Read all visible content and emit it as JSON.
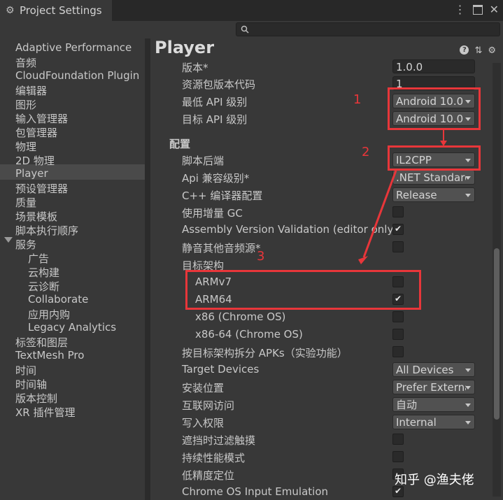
{
  "window": {
    "title": "Project Settings"
  },
  "sidebar": {
    "items": [
      "Adaptive Performance",
      "音频",
      "CloudFoundation Plugin",
      "编辑器",
      "图形",
      "输入管理器",
      "包管理器",
      "物理",
      "2D 物理",
      "Player",
      "预设管理器",
      "质量",
      "场景模板",
      "脚本执行顺序",
      "服务",
      "广告",
      "云构建",
      "云诊断",
      "Collaborate",
      "应用内购",
      "Legacy Analytics",
      "标签和图层",
      "TextMesh Pro",
      "时间",
      "时间轴",
      "版本控制",
      "XR 插件管理"
    ]
  },
  "main": {
    "title": "Player",
    "rows": {
      "version": {
        "label": "版本*",
        "value": "1.0.0"
      },
      "bundle_code": {
        "label": "资源包版本代码",
        "value": "1"
      },
      "min_api": {
        "label": "最低 API 级别",
        "value": "Android 10.0"
      },
      "target_api": {
        "label": "目标 API 级别",
        "value": "Android 10.0"
      },
      "config_header": "配置",
      "scripting_backend": {
        "label": "脚本后端",
        "value": "IL2CPP"
      },
      "api_compat": {
        "label": "Api 兼容级别*",
        "value": ".NET Standard"
      },
      "cpp_config": {
        "label": "C++ 编译器配置",
        "value": "Release"
      },
      "incremental_gc": {
        "label": "使用增量 GC"
      },
      "assembly_validation": {
        "label": "Assembly Version Validation (editor only)"
      },
      "mute_audio": {
        "label": "静音其他音频源*"
      },
      "target_arch": {
        "label": "目标架构"
      },
      "armv7": {
        "label": "ARMv7"
      },
      "arm64": {
        "label": "ARM64"
      },
      "x86": {
        "label": "x86 (Chrome OS)"
      },
      "x86_64": {
        "label": "x86-64 (Chrome OS)"
      },
      "split_apks": {
        "label": "按目标架构拆分 APKs（实验功能）"
      },
      "target_devices": {
        "label": "Target Devices",
        "value": "All Devices"
      },
      "install_location": {
        "label": "安装位置",
        "value": "Prefer External"
      },
      "internet_access": {
        "label": "互联网访问",
        "value": "自动"
      },
      "write_permission": {
        "label": "写入权限",
        "value": "Internal"
      },
      "filter_touches": {
        "label": "遮挡时过滤触摸"
      },
      "sustained_perf": {
        "label": "持续性能模式"
      },
      "low_accuracy": {
        "label": "低精度定位"
      },
      "chrome_os_input": {
        "label": "Chrome OS Input Emulation"
      }
    }
  },
  "annotations": {
    "n1": "1",
    "n2": "2",
    "n3": "3"
  },
  "watermark": "知乎 @渔夫佬",
  "colors": {
    "highlight": "#e8363a",
    "background": "#383838",
    "field": "#2a2a2a"
  }
}
